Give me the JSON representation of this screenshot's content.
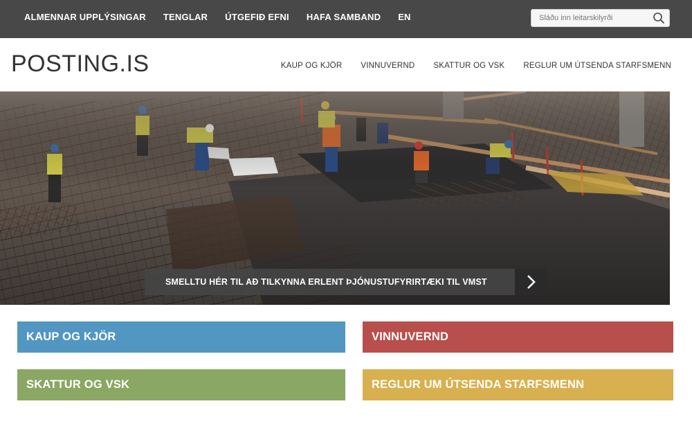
{
  "topbar": {
    "nav": [
      "ALMENNAR UPPLÝSINGAR",
      "TENGLAR",
      "ÚTGEFIÐ EFNI",
      "HAFA SAMBAND",
      "EN"
    ],
    "search_placeholder": "Sláðu inn leitarskilyrði"
  },
  "header": {
    "logo": "POSTING.IS",
    "nav": [
      "KAUP OG KJÖR",
      "VINNUVERND",
      "SKATTUR OG VSK",
      "REGLUR UM ÚTSENDA STARFSMENN"
    ]
  },
  "hero": {
    "cta_label": "SMELLTU HÉR TIL AÐ TILKYNNA ERLENT ÞJÓNUSTUFYRIRTÆKI TIL VMST"
  },
  "tiles": [
    {
      "label": "KAUP OG KJÖR",
      "color": "#5296c2"
    },
    {
      "label": "VINNUVERND",
      "color": "#b84f4c"
    },
    {
      "label": "SKATTUR OG VSK",
      "color": "#8aa763"
    },
    {
      "label": "REGLUR UM ÚTSENDA STARFSMENN",
      "color": "#d9b04f"
    }
  ],
  "colors": {
    "topbar": "#484848",
    "cta_arrow_bg": "#2a2a2a"
  }
}
